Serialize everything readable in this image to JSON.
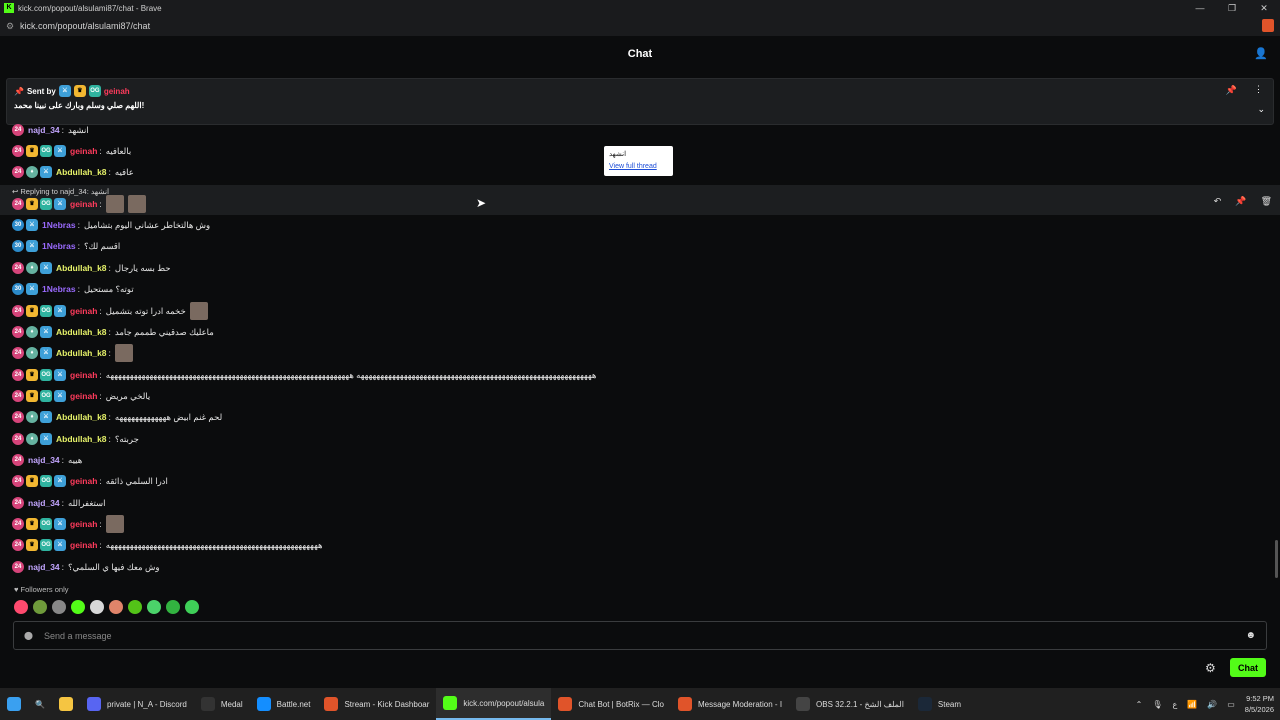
{
  "window": {
    "title": "kick.com/popout/alsulami87/chat - Brave",
    "url": "kick.com/popout/alsulami87/chat"
  },
  "header": {
    "title": "Chat"
  },
  "pinned": {
    "sent_by_label": "Sent by",
    "username": "geinah",
    "message": "اللهم صلي وسلم وبارك على نبينا محمد!"
  },
  "tooltip": {
    "text": "انشهد",
    "link": "View full thread"
  },
  "reply": {
    "label": "Replying to najd_34:",
    "quote": "انشهد"
  },
  "messages": [
    {
      "user": "najd_34",
      "color": "#c3a6ff",
      "text": "انشهد",
      "badges": [
        "sub"
      ]
    },
    {
      "user": "geinah",
      "color": "#ff3b5c",
      "text": "بالعافيه",
      "badges": [
        "sub",
        "crown",
        "og",
        "sword"
      ]
    },
    {
      "user": "Abdullah_k8",
      "color": "#e7f36a",
      "text": "عافيه",
      "badges": [
        "sub",
        "vip",
        "sword"
      ]
    },
    {
      "user": "geinah",
      "color": "#ff3b5c",
      "text": "",
      "badges": [
        "sub",
        "crown",
        "og",
        "sword"
      ],
      "emotes": 2
    },
    {
      "user": "1Nebras",
      "color": "#9b6bff",
      "text": "وش هالتخاطر عشاني اليوم بتشاميل",
      "badges": [
        "sub30",
        "sword"
      ]
    },
    {
      "user": "1Nebras",
      "color": "#9b6bff",
      "text": "اقسم لك؟",
      "badges": [
        "sub30",
        "sword"
      ]
    },
    {
      "user": "Abdullah_k8",
      "color": "#e7f36a",
      "text": "حط بسه يارجال",
      "badges": [
        "sub",
        "vip",
        "sword"
      ]
    },
    {
      "user": "1Nebras",
      "color": "#9b6bff",
      "text": "توته؟ مستحيل",
      "badges": [
        "sub30",
        "sword"
      ]
    },
    {
      "user": "geinah",
      "color": "#ff3b5c",
      "text": "خخمه ادرا توته بتشميل",
      "badges": [
        "sub",
        "crown",
        "og",
        "sword"
      ],
      "emotes": 1
    },
    {
      "user": "Abdullah_k8",
      "color": "#e7f36a",
      "text": "ماعليك صدقيني طممم جامد",
      "badges": [
        "sub",
        "vip",
        "sword"
      ]
    },
    {
      "user": "Abdullah_k8",
      "color": "#e7f36a",
      "text": "",
      "badges": [
        "sub",
        "vip",
        "sword"
      ],
      "emotes": 1
    },
    {
      "user": "geinah",
      "color": "#ff3b5c",
      "text": "ههههههههههههههههههههههههههههههههههههههههههههههههههههههههههههه ههههههههههههههههههههههههههههههههههههههههههههههههههههههههههههههه",
      "badges": [
        "sub",
        "crown",
        "og",
        "sword"
      ]
    },
    {
      "user": "geinah",
      "color": "#ff3b5c",
      "text": "يالخي مريض",
      "badges": [
        "sub",
        "crown",
        "og",
        "sword"
      ]
    },
    {
      "user": "Abdullah_k8",
      "color": "#e7f36a",
      "text": "لحم غنم ابيض هههههههههههههه",
      "badges": [
        "sub",
        "vip",
        "sword"
      ]
    },
    {
      "user": "Abdullah_k8",
      "color": "#e7f36a",
      "text": "جربته؟",
      "badges": [
        "sub",
        "vip",
        "sword"
      ]
    },
    {
      "user": "najd_34",
      "color": "#c3a6ff",
      "text": "هييه",
      "badges": [
        "sub"
      ]
    },
    {
      "user": "geinah",
      "color": "#ff3b5c",
      "text": "ادرا السلمي ذائقه",
      "badges": [
        "sub",
        "crown",
        "og",
        "sword"
      ]
    },
    {
      "user": "najd_34",
      "color": "#c3a6ff",
      "text": "استغفرالله",
      "badges": [
        "sub"
      ]
    },
    {
      "user": "geinah",
      "color": "#ff3b5c",
      "text": "",
      "badges": [
        "sub",
        "crown",
        "og",
        "sword"
      ],
      "emotes": 1
    },
    {
      "user": "geinah",
      "color": "#ff3b5c",
      "text": "ههههههههههههههههههههههههههههههههههههههههههههههههههههههه",
      "badges": [
        "sub",
        "crown",
        "og",
        "sword"
      ]
    },
    {
      "user": "najd_34",
      "color": "#c3a6ff",
      "text": "وش معك فيها ي السلمي؟",
      "badges": [
        "sub"
      ]
    }
  ],
  "footer": {
    "followers_only": "Followers only",
    "input_placeholder": "Send a message",
    "chat_button": "Chat"
  },
  "taskbar": {
    "items": [
      {
        "label": "private | N_A - Discord",
        "color": "#5865f2"
      },
      {
        "label": "Medal",
        "color": "#333"
      },
      {
        "label": "Battle.net",
        "color": "#148eff"
      },
      {
        "label": "Stream - Kick Dashboar",
        "color": "#e0542a"
      },
      {
        "label": "kick.com/popout/alsula",
        "color": "#53fc18"
      },
      {
        "label": "Chat Bot | BotRix — Clo",
        "color": "#e0542a"
      },
      {
        "label": "Message Moderation - I",
        "color": "#e0542a"
      },
      {
        "label": "OBS 32.2.1 - الملف الشخ",
        "color": "#444"
      },
      {
        "label": "Steam",
        "color": "#1b2838"
      }
    ],
    "time": "9:52 PM",
    "date": "8/5/2026",
    "lang": "ع"
  },
  "colors": {
    "accent": "#53fc18",
    "background": "#0b0c0d"
  }
}
